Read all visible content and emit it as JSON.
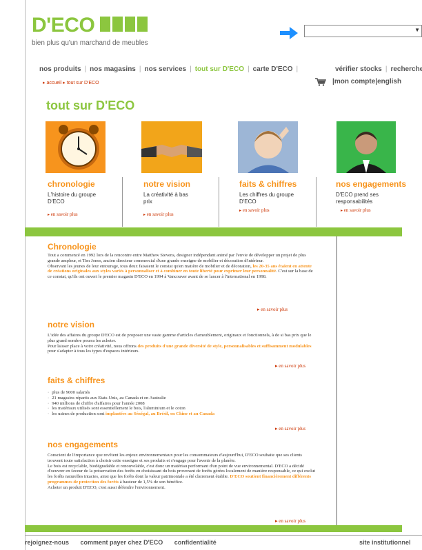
{
  "header": {
    "logo_text": "D'ECO",
    "tagline": "bien plus qu'un marchand de meubles",
    "search_value": ""
  },
  "nav": {
    "items": [
      "nos produits",
      "nos magasins",
      "nos services",
      "tout sur D'ECO",
      "carte D'ECO"
    ],
    "active_index": 3
  },
  "utility": {
    "top": [
      "vérifier stocks",
      "recherche"
    ],
    "bottom": [
      "mon compte",
      "english"
    ]
  },
  "breadcrumb": [
    "accueil",
    "tout sur D'ECO"
  ],
  "page_title": "tout sur D'ECO",
  "cards": [
    {
      "title": "chronologie",
      "desc": "L'histoire du groupe D'ECO",
      "link": "en savoir plus",
      "image": "clock-image"
    },
    {
      "title": "notre vision",
      "desc": "La créativité à bas prix",
      "link": "en savoir plus",
      "image": "handshake-image"
    },
    {
      "title": "faits & chiffres",
      "desc": "Les chiffres du groupe D'ECO",
      "link": "en savoir plus",
      "image": "child-image"
    },
    {
      "title": "nos engagements",
      "desc": "D'ECO prend ses responsabilités",
      "link": "en savoir plus",
      "image": "man-portrait-image"
    }
  ],
  "sections": {
    "chronologie": {
      "title": "Chronologie",
      "p1a": "Tout a commencé en 1992 lors de la rencontre entre Matthew Stevens, designer indépendant animé par l'envie de développer un projet de plus grande ampleur, et Tim Jones, ancien directeur commercial d'une grande enseigne de mobilier et décoration d'intérieur.",
      "p2a": "Observant les jeunes de leur entourage, tous deux faisaient le constat qu'en matière de mobilier et de décoration, ",
      "p2hl": "les 20-35 ans étaient en attente de créations originales aux styles variés à personnaliser et à combiner en toute liberté pour exprimer leur personnalité",
      "p2b": ". C'est sur la base de ce constat, qu'ils ont ouvert le premier magasin D'ECO en 1994 à Vancouver avant de se lancer à l'international en 1998.",
      "more": "en savoir plus"
    },
    "vision": {
      "title": "notre vision",
      "p1": "L'idée des affaires du groupe D'ECO est de proposer une vaste gamme d'articles d'ameublement, originaux et fonctionnels, à de si bas prix que le plus grand nombre pourra les acheter.",
      "p2a": "Pour laisser place à votre créativité, nous offrons ",
      "p2hl": "des produits d'une grande diversité de style, personnalisables et suffisamment modulables",
      "p2b": " pour s'adapter à tous les types d'espaces intérieurs.",
      "more": "en savoir plus"
    },
    "faits": {
      "title": "faits & chiffres",
      "items": [
        "plus de 9000 salariés",
        "21 magasins répartis aux Etats-Unis, au Canada et en Australie",
        "940 millions de chiffre d'affaires pour l'année 2008",
        "les matériaux utilisés sont essentiellement le bois, l'aluminium et le coton"
      ],
      "last_a": "les usines de production sont ",
      "last_hl": "implantées au Sénégal, au Brésil, en Chine et au Canada",
      "more": "en savoir plus"
    },
    "engagements": {
      "title": "nos engagements",
      "p1": "Conscient de l'importance que revêtent les enjeux environnementaux pour les consommateurs d'aujourd'hui, D'ECO souhaite que ses clients trouvent toute satisfaction à choisir cette enseigne et ses produits et s'engage pour l'avenir de la planète.",
      "p2": "Le bois est recyclable, biodégradable et renouvelable, c'est donc un matériau performant d'un point de vue environnemental. D'ECO a décidé d'oeuvrer en faveur de la préservation des forêts en choisissant du bois provenant de forêts gérées localement de manière responsable, ce qui exclut les forêts naturelles intactes, ainsi que les forêts dont la valeur patrimoniale a été clairement établie. ",
      "p2hl": "D'ECO soutient financièrement différents programmes de protection des forêts",
      "p2b": " à hauteur de 1,5% de son bénéfice.",
      "p3": "Acheter un produit D'ECO, c'est aussi défendre l'environnement.",
      "more": "en savoir plus"
    }
  },
  "footer": {
    "left": [
      "rejoignez-nous",
      "comment payer chez D'ECO",
      "confidentialité"
    ],
    "right": "site institutionnel"
  },
  "colors": {
    "brand_green": "#8cc63f",
    "orange": "#f7941d",
    "link_red": "#cc3300",
    "arrow_blue": "#1e90ff"
  }
}
